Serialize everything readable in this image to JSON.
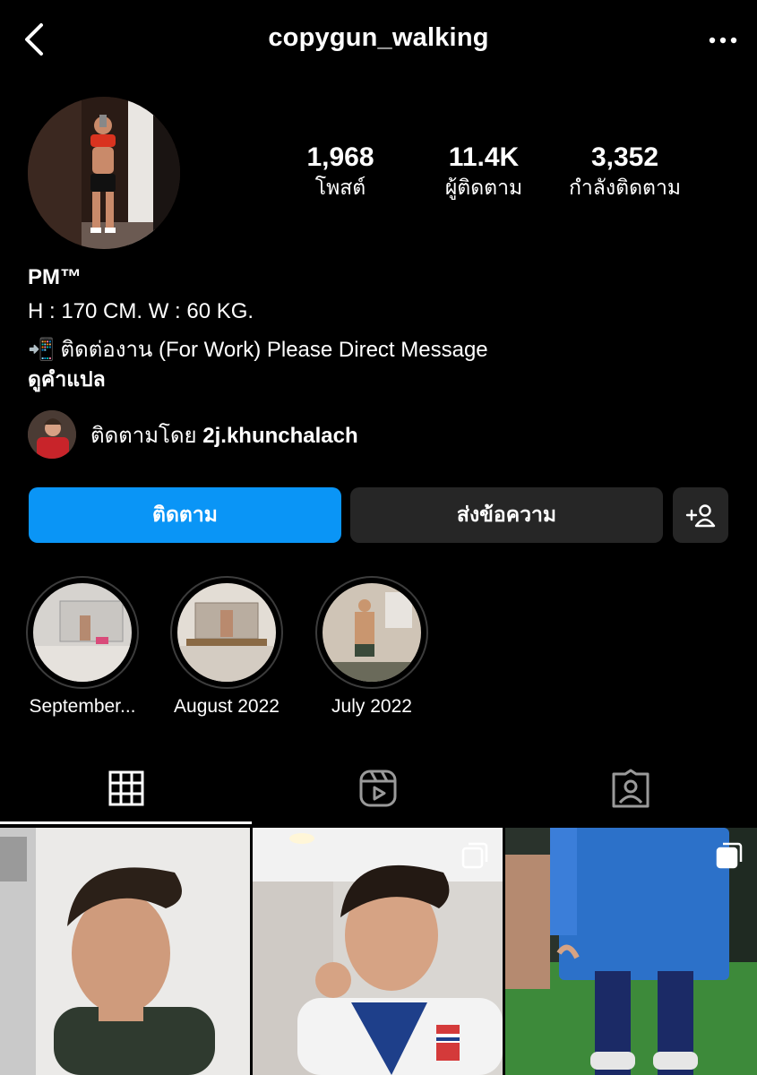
{
  "header": {
    "username": "copygun_walking",
    "back_icon": "chevron-left-icon",
    "more_icon": "more-horizontal-icon"
  },
  "stats": {
    "posts_count": "1,968",
    "posts_label": "โพสต์",
    "followers_count": "11.4K",
    "followers_label": "ผู้ติดตาม",
    "following_count": "3,352",
    "following_label": "กำลังติดตาม"
  },
  "bio": {
    "name": "PM™",
    "line1": "H : 170 CM. W : 60 KG.",
    "line2": "📲 ติดต่องาน (For Work) Please Direct Message",
    "translate": "ดูคำแปล"
  },
  "followed_by": {
    "prefix": "ติดตามโดย",
    "user": "2j.khunchalach"
  },
  "actions": {
    "follow_label": "ติดตาม",
    "message_label": "ส่งข้อความ",
    "add_user_icon": "add-user-icon"
  },
  "highlights": [
    {
      "label": "September..."
    },
    {
      "label": "August 2022"
    },
    {
      "label": "July 2022"
    }
  ],
  "tabs": [
    {
      "icon": "grid-icon",
      "active": true
    },
    {
      "icon": "reels-icon",
      "active": false
    },
    {
      "icon": "tagged-icon",
      "active": false
    }
  ],
  "colors": {
    "background": "#000000",
    "follow_button": "#0a95f6",
    "secondary_button": "#262626",
    "text": "#ffffff"
  }
}
